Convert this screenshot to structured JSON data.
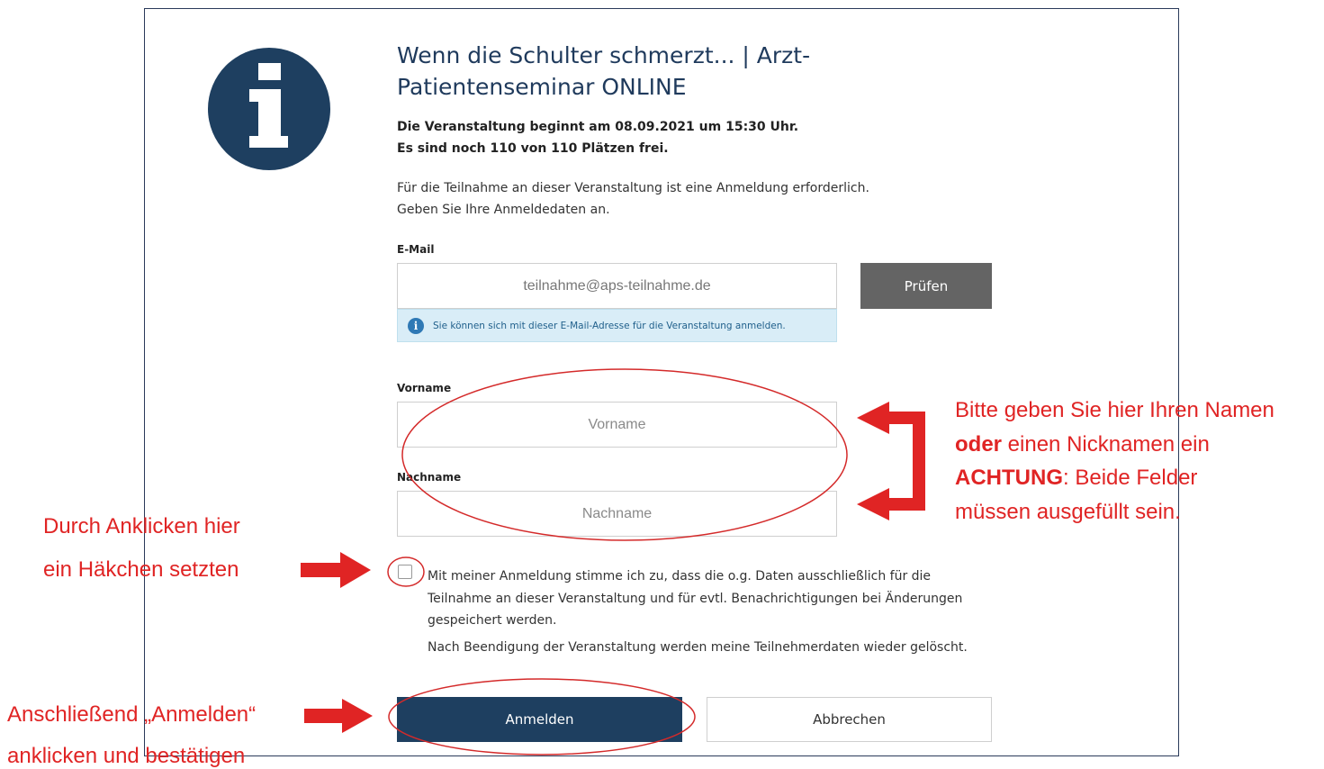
{
  "event": {
    "title": "Wenn die Schulter schmerzt... | Arzt-Patientenseminar ONLINE",
    "start_line": "Die Veranstaltung beginnt am 08.09.2021 um 15:30 Uhr.",
    "seats_line": "Es sind noch 110 von 110 Plätzen frei.",
    "intro_line1": "Für die Teilnahme an dieser Veranstaltung ist eine Anmeldung erforderlich.",
    "intro_line2": "Geben Sie Ihre Anmeldedaten an."
  },
  "form": {
    "email_label": "E-Mail",
    "email_value": "teilnahme@aps-teilnahme.de",
    "check_button": "Prüfen",
    "email_hint": "Sie können sich mit dieser E-Mail-Adresse für die Veranstaltung anmelden.",
    "firstname_label": "Vorname",
    "firstname_placeholder": "Vorname",
    "lastname_label": "Nachname",
    "lastname_placeholder": "Nachname",
    "consent_text": "Mit meiner Anmeldung stimme ich zu, dass die o.g. Daten ausschließlich für die Teilnahme an dieser Veranstaltung und für evtl. Benachrichtigungen bei Änderungen gespeichert werden.",
    "deletion_note": "Nach Beendigung der Veranstaltung werden meine Teilnehmerdaten wieder gelöscht.",
    "consent_checked": false,
    "submit_button": "Anmelden",
    "cancel_button": "Abbrechen"
  },
  "annotations": {
    "names_line1": "Bitte geben Sie hier Ihren Namen",
    "names_line2_bold": "oder",
    "names_line2_rest": " einen Nicknamen ein",
    "names_line3_bold": "ACHTUNG",
    "names_line3_rest": ": Beide Felder",
    "names_line4": "müssen ausgefüllt sein.",
    "checkbox_line1": "Durch Anklicken hier",
    "checkbox_line2": "ein Häkchen setzten",
    "submit_line1": "Anschließend „Anmelden“",
    "submit_line2": "anklicken und bestätigen"
  },
  "colors": {
    "primary": "#1e3f60",
    "annotation_red": "#e02424",
    "hint_background": "#d9edf7",
    "check_button": "#646464"
  },
  "icons": {
    "main": "info-icon",
    "hint": "info-icon"
  }
}
